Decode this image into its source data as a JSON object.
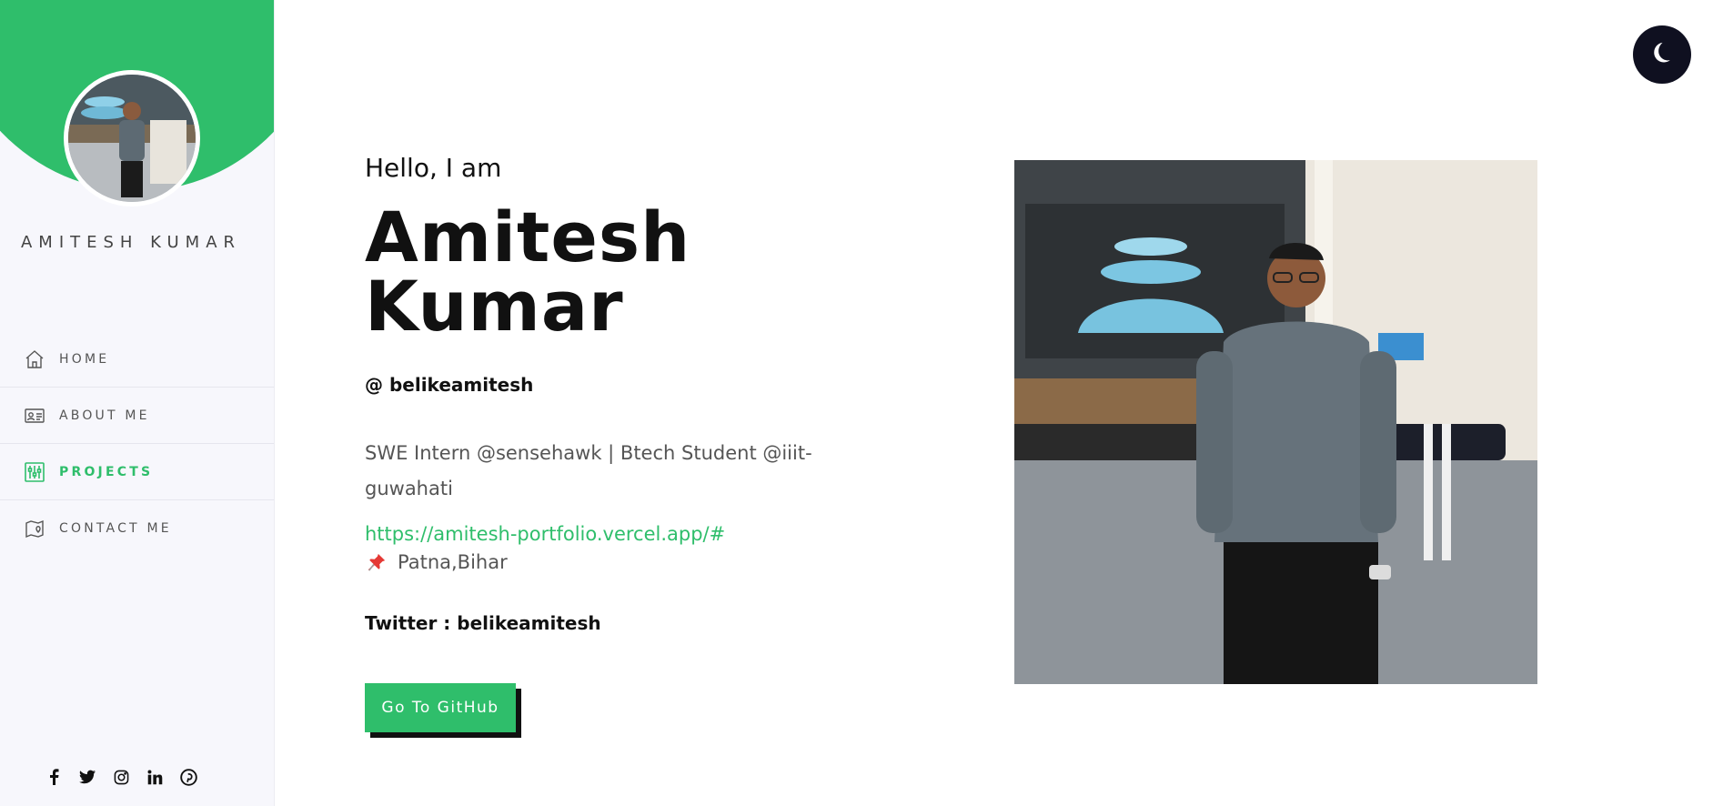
{
  "sidebar": {
    "name": "AMITESH KUMAR",
    "items": [
      {
        "label": "HOME",
        "icon": "home-icon",
        "active": false
      },
      {
        "label": "ABOUT ME",
        "icon": "id-card-icon",
        "active": false
      },
      {
        "label": "PROJECTS",
        "icon": "sliders-icon",
        "active": true
      },
      {
        "label": "CONTACT ME",
        "icon": "map-pin-icon",
        "active": false
      }
    ],
    "socials": [
      "facebook-icon",
      "twitter-icon",
      "instagram-icon",
      "linkedin-icon",
      "pinterest-icon"
    ]
  },
  "hero": {
    "greeting": "Hello, I am",
    "name": "Amitesh Kumar",
    "handle": "@ belikeamitesh",
    "bio": "SWE Intern @sensehawk | Btech Student @iiit-guwahati",
    "link": "https://amitesh-portfolio.vercel.app/#",
    "location": "Patna,Bihar",
    "twitter": "Twitter : belikeamitesh",
    "button_label": "Go To GitHub"
  },
  "colors": {
    "accent": "#2fbe6b",
    "dark": "#0f1020",
    "sidebar_bg": "#f7f7fc"
  }
}
